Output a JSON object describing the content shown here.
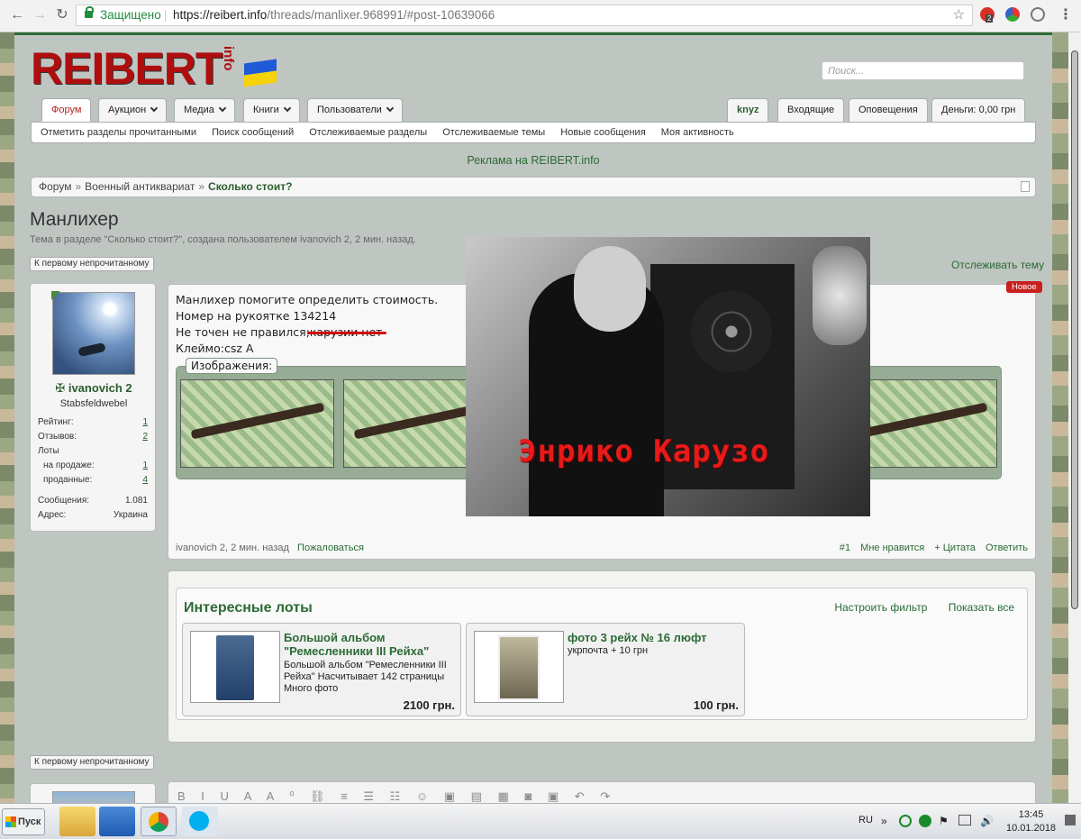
{
  "browser": {
    "secure_label": "Защищено",
    "url_host": "https://reibert.info",
    "url_path": "/threads/manlixer.968991/#post-10639066",
    "ext_badge": "2"
  },
  "site": {
    "logo": "REIBERT",
    "logo_suffix": "info",
    "search_placeholder": "Поиск...",
    "tabs_left": [
      {
        "label": "Форум"
      },
      {
        "label": "Аукцион"
      },
      {
        "label": "Медиа"
      },
      {
        "label": "Книги"
      },
      {
        "label": "Пользователи"
      }
    ],
    "tabs_right": [
      {
        "label": "knyz"
      },
      {
        "label": "Входящие"
      },
      {
        "label": "Оповещения"
      },
      {
        "label": "Деньги: 0,00 грн"
      }
    ],
    "subnav": [
      "Отметить разделы прочитанными",
      "Поиск сообщений",
      "Отслеживаемые разделы",
      "Отслеживаемые темы",
      "Новые сообщения",
      "Моя активность"
    ],
    "ad": "Реклама на REIBERT.info",
    "breadcrumb": [
      "Форум",
      "Военный антиквариат",
      "Сколько стоит?"
    ]
  },
  "thread": {
    "title": "Манлихер",
    "description": "Тема в разделе \"Сколько стоит?\", создана пользователем ivanovich 2, 2 мин. назад.",
    "first_unread": "К первому непрочитанному",
    "watch": "Отслеживать тему"
  },
  "user": {
    "name": "ivanovich 2",
    "rank": "Stabsfeldwebel",
    "stats": [
      {
        "label": "Рейтинг:",
        "value": "1"
      },
      {
        "label": "Отзывов:",
        "value": "2"
      },
      {
        "label": "Лоты",
        "value": ""
      },
      {
        "label": "на продаже:",
        "value": "1"
      },
      {
        "label": "проданные:",
        "value": "4"
      },
      {
        "label": "Сообщения:",
        "value": "1.081"
      },
      {
        "label": "Адрес:",
        "value": "Украина"
      }
    ]
  },
  "post": {
    "badge": "Новое",
    "lines": [
      "Манлихер помогите определить стоимость.",
      "Номер на рукоятке 134214",
      "Не точен не правился;карузии нет",
      "Клеймо:csz A"
    ],
    "attachments_label": "Изображения:",
    "meta_author": "ivanovich 2, 2 мин. назад",
    "report": "Пожаловаться",
    "number": "#1",
    "like": "Мне нравится",
    "quote": "+ Цитата",
    "reply": "Ответить"
  },
  "overlay": {
    "caption": "Энрико  Карузо"
  },
  "lots": {
    "title": "Интересные лоты",
    "filter": "Настроить фильтр",
    "show_all": "Показать все",
    "items": [
      {
        "title": "Большой альбом \"Ремесленники III Рейха\"",
        "text": "Большой альбом \"Ремесленники III Рейха\" Насчитывает 142 страницы Много фото",
        "price": "2100 грн."
      },
      {
        "title": "фото 3 рейх № 16 люфт",
        "text": "укрпочта + 10 грн",
        "price": "100 грн."
      }
    ]
  },
  "taskbar": {
    "start": "Пуск",
    "lang": "RU",
    "time": "13:45",
    "date": "10.01.2018"
  }
}
